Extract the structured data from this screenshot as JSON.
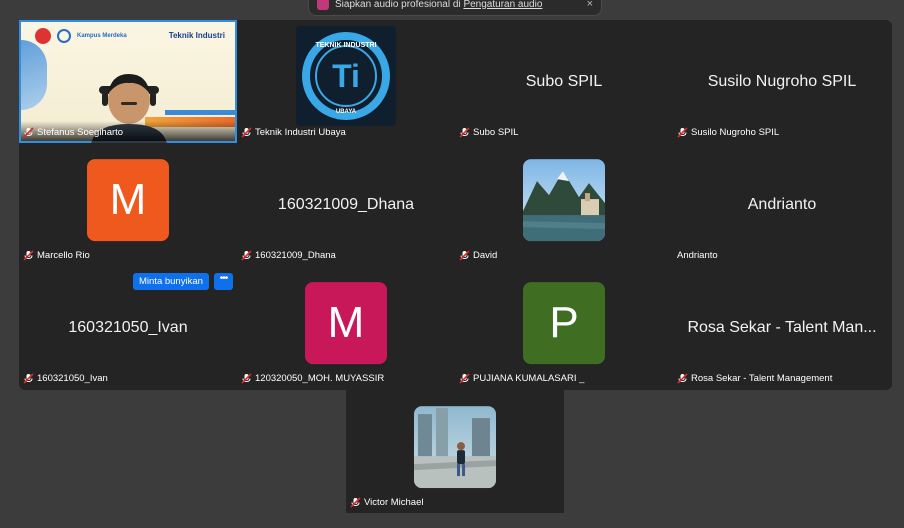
{
  "notification": {
    "text": "Siapkan audio profesional di ",
    "link": "Pengaturan audio",
    "close": "×"
  },
  "speaker": {
    "name": "Stefanus Soegiharto",
    "dept": "Teknik Industri",
    "kampus": "Kampus Merdeka"
  },
  "tiles": [
    {
      "name": "Teknik Industri Ubaya",
      "kind": "logo",
      "logo_text": "TEKNIK INDUSTRI",
      "logo_mark": "Ti",
      "logo_sub": "UBAYA"
    },
    {
      "name": "Subo SPIL",
      "kind": "text",
      "display": "Subo SPIL"
    },
    {
      "name": "Susilo Nugroho SPIL",
      "kind": "text",
      "display": "Susilo Nugroho SPIL"
    },
    {
      "name": "Marcello Rio",
      "kind": "avatar",
      "initial": "M",
      "color": "#f0591e"
    },
    {
      "name": "160321009_Dhana",
      "kind": "text",
      "display": "160321009_Dhana"
    },
    {
      "name": "David",
      "kind": "photo"
    },
    {
      "name": "Andrianto",
      "kind": "text",
      "display": "Andrianto"
    },
    {
      "name": "160321050_Ivan",
      "kind": "text",
      "display": "160321050_Ivan"
    },
    {
      "name": "120320050_MOH. MUYASSIR",
      "kind": "avatar",
      "initial": "M",
      "color": "#c8185a"
    },
    {
      "name": "PUJIANA KUMALASARI _",
      "kind": "avatar",
      "initial": "P",
      "color": "#3f6e22"
    },
    {
      "name": "Rosa Sekar - Talent Management",
      "kind": "text",
      "display": "Rosa Sekar - Talent Man..."
    }
  ],
  "bottom": {
    "name": "Victor Michael"
  },
  "hover": {
    "ask_unmute": "Minta bunyikan",
    "more": "•••"
  },
  "colors": {
    "accent": "#0e71eb",
    "muted": "#e02828",
    "tile_bg": "#242424",
    "speaker_border": "#2f8fe0"
  }
}
